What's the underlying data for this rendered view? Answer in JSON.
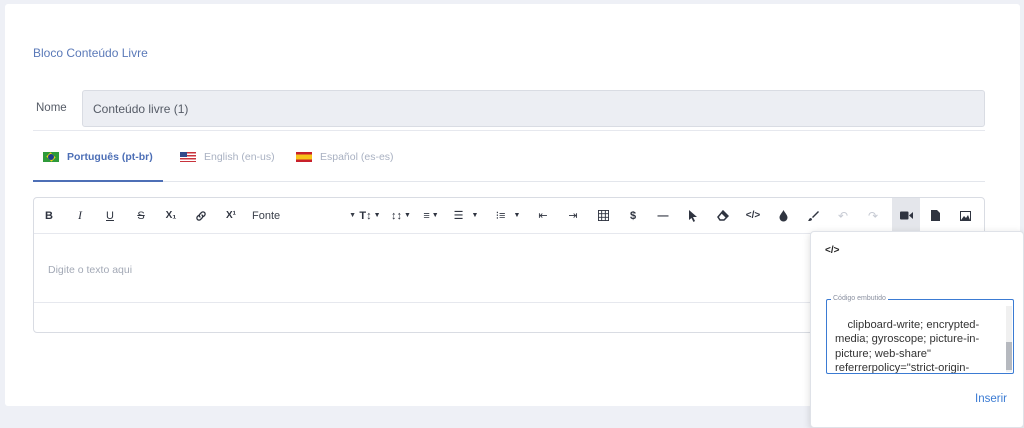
{
  "section": {
    "title": "Bloco Conteúdo Livre"
  },
  "name_field": {
    "label": "Nome",
    "value": "Conteúdo livre (1)"
  },
  "tabs": [
    {
      "label": "Português (pt-br)",
      "flag": "flag-brazil",
      "active": true
    },
    {
      "label": "English (en-us)",
      "flag": "flag-usa",
      "active": false
    },
    {
      "label": "Español (es-es)",
      "flag": "flag-spain",
      "active": false
    }
  ],
  "toolbar": {
    "bold": "B",
    "italic": "I",
    "underline": "U",
    "strikethrough": "S",
    "subscript": "X₁",
    "link_icon": "link-icon",
    "superscript": "X¹",
    "font_label": "Fonte",
    "icons": [
      "font-size-icon",
      "line-height-icon",
      "align-icon",
      "ordered-list-icon",
      "unordered-list-icon",
      "outdent-icon",
      "indent-icon",
      "table-icon",
      "dollar-icon",
      "horizontal-rule-icon",
      "cursor-icon",
      "eraser-icon",
      "code-icon",
      "color-drop-icon",
      "brush-icon",
      "undo-icon",
      "redo-icon",
      "video-icon",
      "file-icon",
      "image-icon"
    ]
  },
  "editor": {
    "placeholder": "Digite o texto aqui"
  },
  "embed_popup": {
    "code_label": "Código embutido",
    "code_value": "clipboard-write; encrypted-media; gyroscope; picture-in-picture; web-share\" referrerpolicy=\"strict-origin-when-cross-origin\" allowfullscreen></iframe>",
    "insert_label": "Inserir"
  },
  "colors": {
    "accent": "#4d6fb6",
    "link": "#3b7bd3",
    "background": "#eef0f6"
  }
}
